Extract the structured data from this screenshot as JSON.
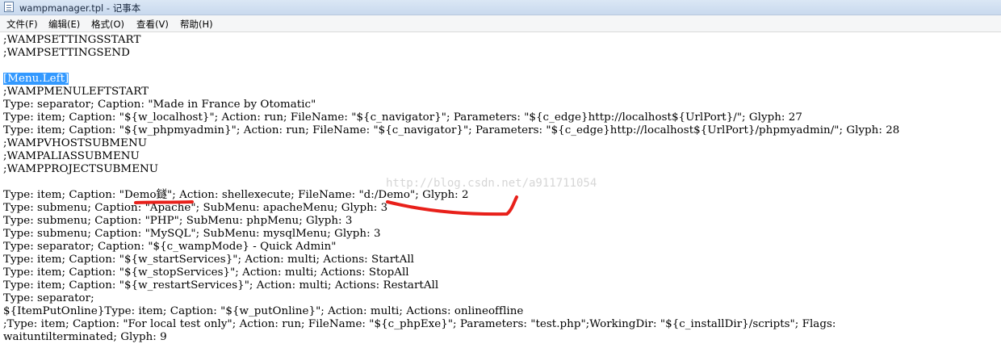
{
  "window": {
    "title": "wampmanager.tpl - 记事本"
  },
  "menubar": {
    "items": [
      "文件(F)",
      "编辑(E)",
      "格式(O)",
      "查看(V)",
      "帮助(H)"
    ]
  },
  "editor": {
    "lines": [
      ";WAMPSETTINGSSTART",
      ";WAMPSETTINGSEND",
      "",
      "",
      ";WAMPMENULEFTSTART",
      "Type: separator; Caption: \"Made in France by Otomatic\"",
      "Type: item; Caption: \"${w_localhost}\"; Action: run; FileName: \"${c_navigator}\"; Parameters: \"${c_edge}http://localhost${UrlPort}/\"; Glyph: 27",
      "Type: item; Caption: \"${w_phpmyadmin}\"; Action: run; FileName: \"${c_navigator}\"; Parameters: \"${c_edge}http://localhost${UrlPort}/phpmyadmin/\"; Glyph: 28",
      ";WAMPVHOSTSUBMENU",
      ";WAMPALIASSUBMENU",
      ";WAMPPROJECTSUBMENU",
      "",
      "Type: item; Caption: \"Demo鐩\"; Action: shellexecute; FileName: \"d:/Demo\"; Glyph: 2",
      "Type: submenu; Caption: \"Apache\"; SubMenu: apacheMenu; Glyph: 3",
      "Type: submenu; Caption: \"PHP\"; SubMenu: phpMenu; Glyph: 3",
      "Type: submenu; Caption: \"MySQL\"; SubMenu: mysqlMenu; Glyph: 3",
      "Type: separator; Caption: \"${c_wampMode} - Quick Admin\"",
      "Type: item; Caption: \"${w_startServices}\"; Action: multi; Actions: StartAll",
      "Type: item; Caption: \"${w_stopServices}\"; Action: multi; Actions: StopAll",
      "Type: item; Caption: \"${w_restartServices}\"; Action: multi; Actions: RestartAll",
      "Type: separator;",
      "${ItemPutOnline}Type: item; Caption: \"${w_putOnline}\"; Action: multi; Actions: onlineoffline",
      ";Type: item; Caption: \"For local test only\"; Action: run; FileName: \"${c_phpExe}\"; Parameters: \"test.php\";WorkingDir: \"${c_installDir}/scripts\"; Flags:",
      "waituntilterminated; Glyph: 9"
    ],
    "selected_line": "[Menu.Left]",
    "watermark": "http://blog.csdn.net/a911711054",
    "colors": {
      "selection": "#3399ff",
      "annotation": "#e8201a"
    }
  }
}
